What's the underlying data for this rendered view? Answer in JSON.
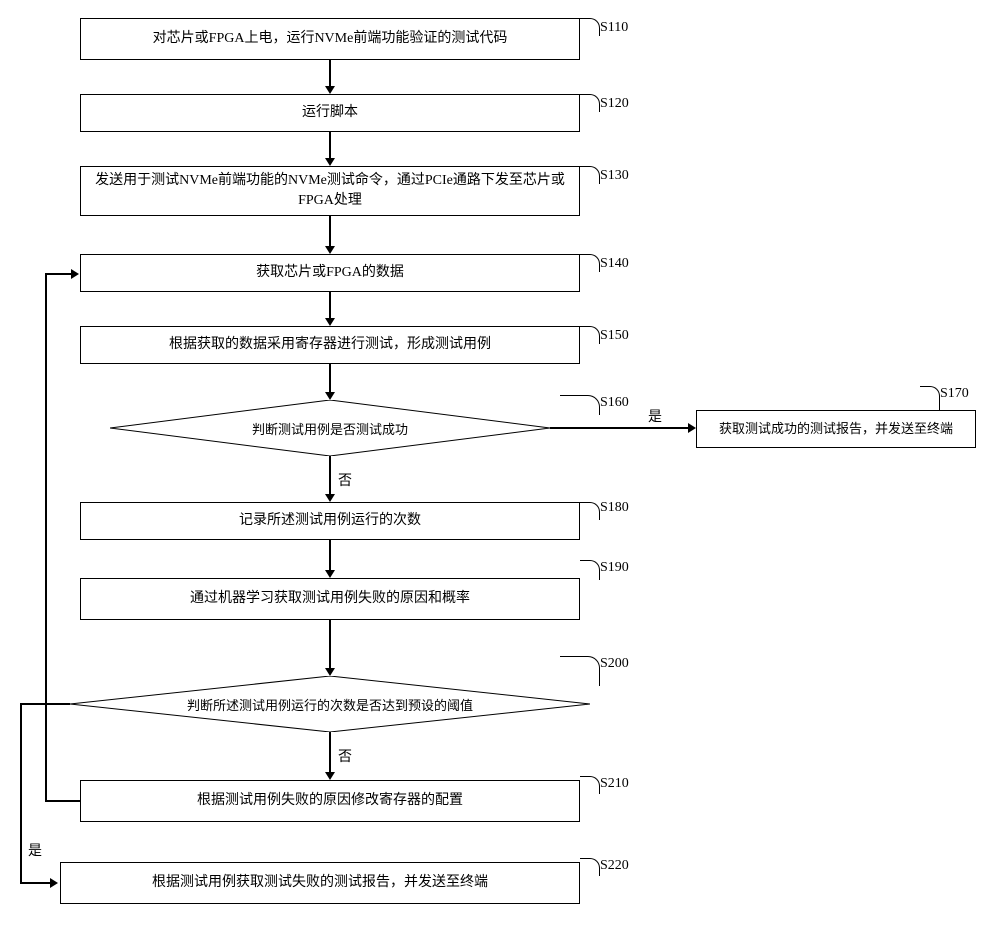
{
  "steps": {
    "s110": {
      "label": "S110",
      "text": "对芯片或FPGA上电，运行NVMe前端功能验证的测试代码"
    },
    "s120": {
      "label": "S120",
      "text": "运行脚本"
    },
    "s130": {
      "label": "S130",
      "text": "发送用于测试NVMe前端功能的NVMe测试命令，通过PCIe通路下发至芯片或FPGA处理"
    },
    "s140": {
      "label": "S140",
      "text": "获取芯片或FPGA的数据"
    },
    "s150": {
      "label": "S150",
      "text": "根据获取的数据采用寄存器进行测试，形成测试用例"
    },
    "s160": {
      "label": "S160",
      "text": "判断测试用例是否测试成功"
    },
    "s170": {
      "label": "S170",
      "text": "获取测试成功的测试报告，并发送至终端"
    },
    "s180": {
      "label": "S180",
      "text": "记录所述测试用例运行的次数"
    },
    "s190": {
      "label": "S190",
      "text": "通过机器学习获取测试用例失败的原因和概率"
    },
    "s200": {
      "label": "S200",
      "text": "判断所述测试用例运行的次数是否达到预设的阈值"
    },
    "s210": {
      "label": "S210",
      "text": "根据测试用例失败的原因修改寄存器的配置"
    },
    "s220": {
      "label": "S220",
      "text": "根据测试用例获取测试失败的测试报告，并发送至终端"
    }
  },
  "edges": {
    "yes": "是",
    "no": "否"
  }
}
